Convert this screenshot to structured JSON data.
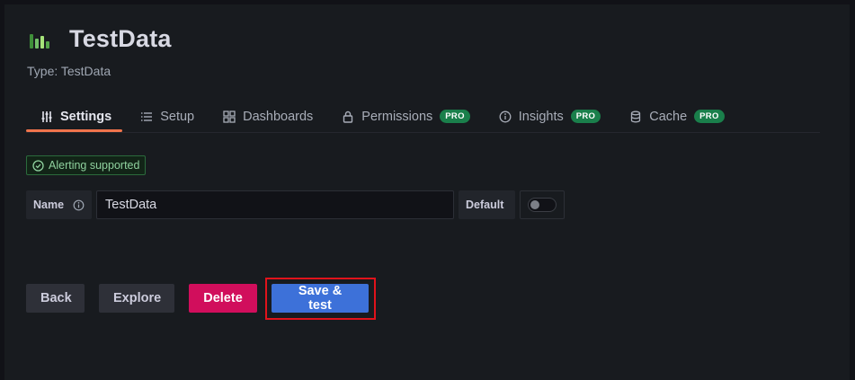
{
  "header": {
    "title": "TestData",
    "subtitle": "Type: TestData",
    "logo_icon": "testdata-logo-icon"
  },
  "tabs": [
    {
      "label": "Settings",
      "icon": "sliders-icon",
      "active": true,
      "pro": ""
    },
    {
      "label": "Setup",
      "icon": "list-icon",
      "active": false,
      "pro": ""
    },
    {
      "label": "Dashboards",
      "icon": "apps-icon",
      "active": false,
      "pro": ""
    },
    {
      "label": "Permissions",
      "icon": "lock-icon",
      "active": false,
      "pro": "PRO"
    },
    {
      "label": "Insights",
      "icon": "info-circle-icon",
      "active": false,
      "pro": "PRO"
    },
    {
      "label": "Cache",
      "icon": "database-icon",
      "active": false,
      "pro": "PRO"
    }
  ],
  "alert_badge": {
    "label": "Alerting supported",
    "icon": "check-circle-icon"
  },
  "fields": {
    "name_label": "Name",
    "name_value": "TestData",
    "default_label": "Default",
    "default_enabled": false
  },
  "buttons": {
    "back": "Back",
    "explore": "Explore",
    "delete": "Delete",
    "save_test": "Save & test"
  },
  "colors": {
    "accent_tab": "#f0744c",
    "pro_badge": "#1a7f4b",
    "delete": "#d10e5c",
    "primary": "#3d71d9",
    "highlight": "#e0131b"
  }
}
